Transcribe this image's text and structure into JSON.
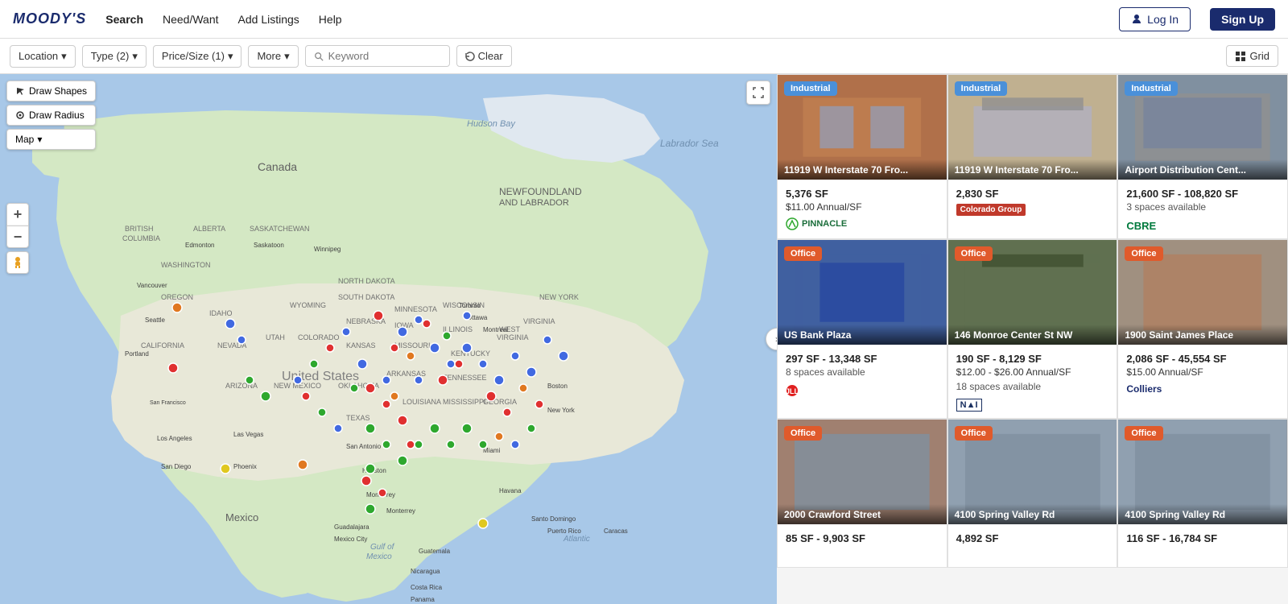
{
  "header": {
    "logo": "MOODY'S",
    "nav": [
      "Search",
      "Need/Want",
      "Add Listings",
      "Help"
    ],
    "active_nav": "Search",
    "login_label": "Log In",
    "signup_label": "Sign Up"
  },
  "filters": {
    "location_label": "Location",
    "type_label": "Type (2)",
    "price_label": "Price/Size (1)",
    "more_label": "More",
    "keyword_placeholder": "Keyword",
    "clear_label": "Clear",
    "grid_label": "Grid"
  },
  "map": {
    "draw_shapes_label": "Draw Shapes",
    "draw_radius_label": "Draw Radius",
    "map_label": "Map",
    "zoom_in": "+",
    "zoom_out": "−"
  },
  "listings": [
    {
      "type": "Industrial",
      "badge_class": "badge-industrial",
      "title": "11919 W Interstate 70 Fro...",
      "size": "5,376 SF",
      "price": "$11.00 Annual/SF",
      "spaces": "",
      "broker": "PINNACLE",
      "broker_class": "broker-name-pinnacle",
      "bg_color": "#b0704a"
    },
    {
      "type": "Industrial",
      "badge_class": "badge-industrial",
      "title": "11919 W Interstate 70 Fro...",
      "size": "2,830 SF",
      "price": "",
      "spaces": "",
      "broker": "Colorado Group",
      "broker_class": "broker-name-colorado",
      "bg_color": "#c0b090"
    },
    {
      "type": "Industrial",
      "badge_class": "badge-industrial",
      "title": "Airport Distribution Cent...",
      "size": "21,600 SF - 108,820 SF",
      "price": "",
      "spaces": "3 spaces available",
      "broker": "CBRE",
      "broker_class": "broker-name-cbre",
      "bg_color": "#8090a0"
    },
    {
      "type": "Office",
      "badge_class": "badge-office",
      "title": "US Bank Plaza",
      "size": "297 SF - 13,348 SF",
      "price": "",
      "spaces": "8 spaces available",
      "broker": "JLL",
      "broker_class": "broker-name-jll",
      "bg_color": "#4060a0"
    },
    {
      "type": "Office",
      "badge_class": "badge-office",
      "title": "146 Monroe Center St NW",
      "size": "190 SF - 8,129 SF",
      "price": "$12.00 - $26.00 Annual/SF",
      "spaces": "18 spaces available",
      "broker": "NAI",
      "broker_class": "broker-name-nai",
      "bg_color": "#607050"
    },
    {
      "type": "Office",
      "badge_class": "badge-office",
      "title": "1900 Saint James Place",
      "size": "2,086 SF - 45,554 SF",
      "price": "$15.00 Annual/SF",
      "spaces": "",
      "broker": "Colliers",
      "broker_class": "broker-name-colliers",
      "bg_color": "#a09080"
    },
    {
      "type": "Office",
      "badge_class": "badge-office",
      "title": "2000 Crawford Street",
      "size": "85 SF - 9,903 SF",
      "price": "",
      "spaces": "",
      "broker": "",
      "broker_class": "",
      "bg_color": "#a08070"
    },
    {
      "type": "Office",
      "badge_class": "badge-office",
      "title": "4100 Spring Valley Rd",
      "size": "4,892 SF",
      "price": "",
      "spaces": "",
      "broker": "",
      "broker_class": "",
      "bg_color": "#90a0b0"
    },
    {
      "type": "Office",
      "badge_class": "badge-office",
      "title": "4100 Spring Valley Rd",
      "size": "116 SF - 16,784 SF",
      "price": "",
      "spaces": "",
      "broker": "",
      "broker_class": "",
      "bg_color": "#90a0b0"
    }
  ],
  "colors": {
    "accent": "#1a2b6d",
    "industrial_badge": "#4a90d9",
    "office_badge": "#e05a2b"
  }
}
